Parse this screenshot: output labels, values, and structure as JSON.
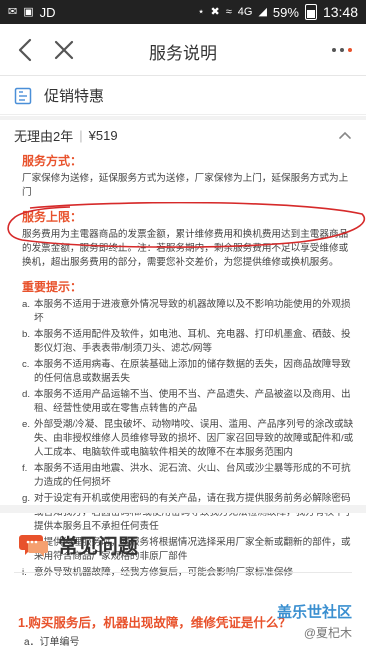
{
  "status_bar": {
    "carrier": "JD",
    "network": "4G",
    "battery": "59%",
    "time": "13:48"
  },
  "nav": {
    "title": "服务说明"
  },
  "promo": {
    "title": "促销特惠"
  },
  "service": {
    "name": "无理由2年",
    "divider": "|",
    "price": "¥519"
  },
  "content": {
    "method_title": "服务方式：",
    "method_text": "厂家保修为送修，延保服务方式为送修，厂家保修为上门，延保服务方式为上门",
    "limit_title": "服务上限：",
    "limit_text": "服务费用为主電器商品的发票金额，累计维修费用和换机费用达到主電器商品的发票金额，服务即终止。注：若服务期内，剩余服务费用不足以享受维修或换机，超出服务费用的部分，需要您补交差价，为您提供维修或换机服务。",
    "tips_title": "重要提示：",
    "tips": [
      {
        "marker": "a",
        "text": "本服务不适用于进液意外情况导致的机器故障以及不影响功能使用的外观损坏"
      },
      {
        "marker": "b",
        "text": "本服务不适用配件及软件，如电池、耳机、充电器、打印机墨盒、硒鼓、投影仪灯泡、手表表带/制须刀头、滤芯/网等"
      },
      {
        "marker": "c",
        "text": "本服务不适用病毒、在原装基础上添加的储存数据的丢失，因商品故障导致的任何信息或数据丢失"
      },
      {
        "marker": "d",
        "text": "本服务不适用产品运输不当、使用不当、产品遗失、产品被盗以及商用、出租、经营性使用或在零售点转售的产品"
      },
      {
        "marker": "e",
        "text": "外部受潮/冷凝、昆虫破坏、动物啃咬、误用、滥用、产品序列号的涂改或缺失、由非授权维修人员维修导致的损坏、因厂家召回导致的故障或配件和/或人工成本、电脑软件或电脑软件相关的故障不在本服务范围内"
      },
      {
        "marker": "f",
        "text": "本服务不适用由地震、洪水、泥石流、火山、台风或沙尘暴等形成的不可抗力造成的任何损坏"
      },
      {
        "marker": "g",
        "text": "对于设定有开机或使用密码的有关产品，请在我方提供服务前务必解除密码或告知我方，若因密码和/或使用密码导致我方无法检测故障，我方有权不予提供本服务且不承担任何责任"
      },
      {
        "marker": "h",
        "text": "在提供修理服务时，本服务将根据情况选择采用厂家全新或翻新的部件，或采用符合商品厂家规格的非原厂部件"
      },
      {
        "marker": "i",
        "text": "意外导致机器故障，经我方修复后，可能会影响厂家标准保修"
      }
    ]
  },
  "faq": {
    "title": "常见问题",
    "question": "1.购买服务后，机器出现故障，维修凭证是什么？",
    "answer": "a．订单编号"
  },
  "watermark": {
    "brand": "盖乐世社区",
    "user": "@夏杞木"
  },
  "colors": {
    "accent": "#e8522c",
    "nav_icon": "#555555",
    "promo_icon": "#4a8fd8",
    "faq_icon": "#e8522c",
    "annotation": "#d62a2a",
    "watermark": "#3a8fd0"
  }
}
